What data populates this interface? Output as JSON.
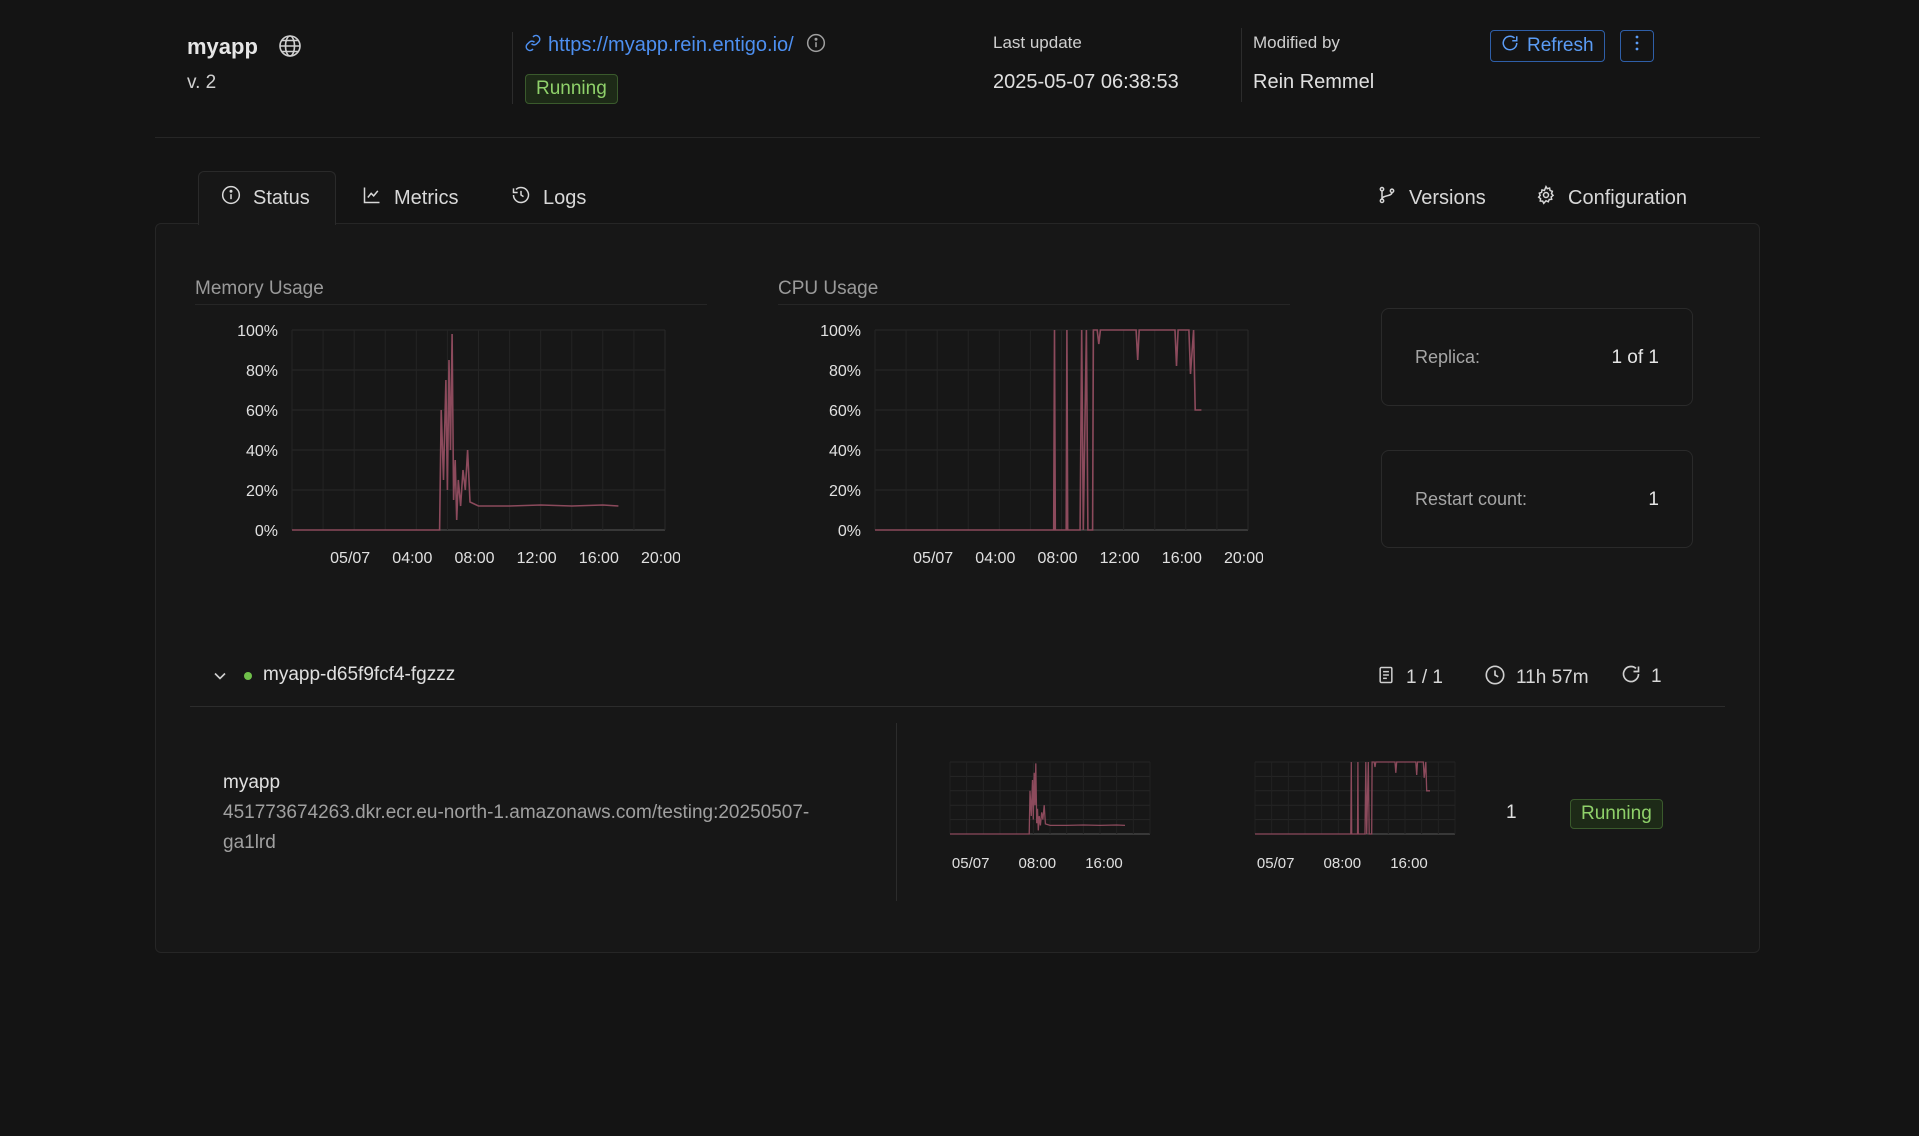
{
  "app": {
    "name": "myapp",
    "version": "v. 2",
    "url": "https://myapp.rein.entigo.io/",
    "status": "Running"
  },
  "header": {
    "last_update_label": "Last update",
    "last_update_value": "2025-05-07 06:38:53",
    "modified_by_label": "Modified by",
    "modified_by_value": "Rein Remmel",
    "refresh_label": "Refresh"
  },
  "tabs": {
    "status": "Status",
    "metrics": "Metrics",
    "logs": "Logs",
    "versions": "Versions",
    "configuration": "Configuration"
  },
  "charts": {
    "memory_title": "Memory Usage",
    "cpu_title": "CPU Usage",
    "y_ticks": [
      "100%",
      "80%",
      "60%",
      "40%",
      "20%",
      "0%"
    ],
    "x_ticks": [
      "05/07",
      "04:00",
      "08:00",
      "12:00",
      "16:00",
      "20:00"
    ],
    "mini_x_ticks": [
      "05/07",
      "08:00",
      "16:00"
    ]
  },
  "stats": {
    "replica_label": "Replica:",
    "replica_value": "1 of 1",
    "restart_label": "Restart count:",
    "restart_value": "1"
  },
  "pod": {
    "name": "myapp-d65f9fcf4-fgzzz",
    "containers": "1 / 1",
    "uptime": "11h 57m",
    "restarts": "1"
  },
  "container": {
    "name": "myapp",
    "image_line1": "451773674263.dkr.ecr.eu-north-1.amazonaws.com/testing:20250507-",
    "image_line2": "ga1lrd",
    "restarts": "1",
    "status": "Running"
  },
  "colors": {
    "series": "#8c4a5c",
    "running_text": "#8fd16a",
    "link": "#4d8ff0"
  },
  "chart_data": [
    {
      "type": "line",
      "title": "Memory Usage",
      "x": [
        "05/07",
        "04:00",
        "08:00",
        "12:00",
        "16:00",
        "20:00"
      ],
      "ylim": [
        0,
        100
      ],
      "y_unit": "%",
      "series": [
        {
          "values": [
            [
              0.0,
              0
            ],
            [
              9.5,
              0
            ],
            [
              9.6,
              60
            ],
            [
              9.75,
              25
            ],
            [
              9.9,
              75
            ],
            [
              10.0,
              20
            ],
            [
              10.1,
              85
            ],
            [
              10.2,
              40
            ],
            [
              10.3,
              98
            ],
            [
              10.4,
              15
            ],
            [
              10.5,
              35
            ],
            [
              10.6,
              5
            ],
            [
              10.7,
              25
            ],
            [
              10.85,
              12
            ],
            [
              11.0,
              30
            ],
            [
              11.15,
              20
            ],
            [
              11.3,
              40
            ],
            [
              11.45,
              14
            ],
            [
              12.0,
              12
            ],
            [
              14.0,
              12
            ],
            [
              16.0,
              12.5
            ],
            [
              18.0,
              12
            ],
            [
              20.0,
              12.5
            ],
            [
              21.0,
              12
            ]
          ]
        }
      ]
    },
    {
      "type": "line",
      "title": "CPU Usage",
      "x": [
        "05/07",
        "04:00",
        "08:00",
        "12:00",
        "16:00",
        "20:00"
      ],
      "ylim": [
        0,
        100
      ],
      "y_unit": "%",
      "series": [
        {
          "values": [
            [
              0.0,
              0
            ],
            [
              11.5,
              0
            ],
            [
              11.55,
              100
            ],
            [
              11.6,
              0
            ],
            [
              12.3,
              0
            ],
            [
              12.35,
              100
            ],
            [
              12.4,
              0
            ],
            [
              13.2,
              0
            ],
            [
              13.3,
              100
            ],
            [
              13.4,
              0
            ],
            [
              13.6,
              100
            ],
            [
              13.7,
              0
            ],
            [
              14.0,
              0
            ],
            [
              14.05,
              100
            ],
            [
              14.3,
              100
            ],
            [
              14.4,
              93
            ],
            [
              14.5,
              100
            ],
            [
              16.8,
              100
            ],
            [
              16.9,
              85
            ],
            [
              17.0,
              100
            ],
            [
              19.3,
              100
            ],
            [
              19.4,
              82
            ],
            [
              19.5,
              100
            ],
            [
              20.2,
              100
            ],
            [
              20.3,
              78
            ],
            [
              20.5,
              100
            ],
            [
              20.6,
              60
            ],
            [
              21.0,
              60
            ]
          ]
        }
      ]
    }
  ]
}
